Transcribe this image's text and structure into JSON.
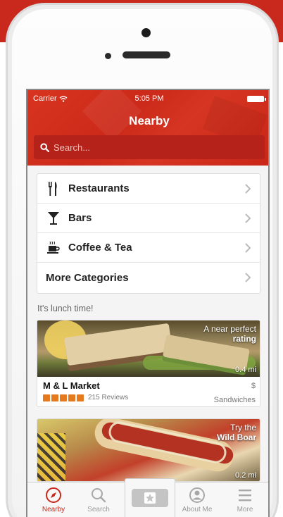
{
  "status_bar": {
    "carrier": "Carrier",
    "time": "5:05 PM"
  },
  "nav": {
    "title": "Nearby"
  },
  "search": {
    "placeholder": "Search..."
  },
  "categories": [
    {
      "label": "Restaurants",
      "icon": "fork-knife-icon"
    },
    {
      "label": "Bars",
      "icon": "martini-glass-icon"
    },
    {
      "label": "Coffee & Tea",
      "icon": "coffee-cup-icon"
    },
    {
      "label": "More Categories",
      "icon": ""
    }
  ],
  "section": {
    "label": "It's lunch time!"
  },
  "cards": [
    {
      "overlay_line1": "A near perfect",
      "overlay_line2": "rating",
      "distance": "0.4 mi",
      "name": "M & L Market",
      "price": "$",
      "stars": 5,
      "reviews": "215 Reviews",
      "category": "Sandwiches"
    },
    {
      "overlay_line1": "Try the",
      "overlay_line2": "Wild Boar",
      "distance": "0.2 mi"
    }
  ],
  "tabs": [
    {
      "label": "Nearby",
      "icon": "compass-icon",
      "active": true
    },
    {
      "label": "Search",
      "icon": "search-icon",
      "active": false
    },
    {
      "label": "",
      "icon": "check-in-star-icon",
      "active": false
    },
    {
      "label": "About Me",
      "icon": "profile-icon",
      "active": false
    },
    {
      "label": "More",
      "icon": "hamburger-menu-icon",
      "active": false
    }
  ],
  "colors": {
    "brand_red": "#c8291b",
    "star_orange": "#e67a1e"
  }
}
